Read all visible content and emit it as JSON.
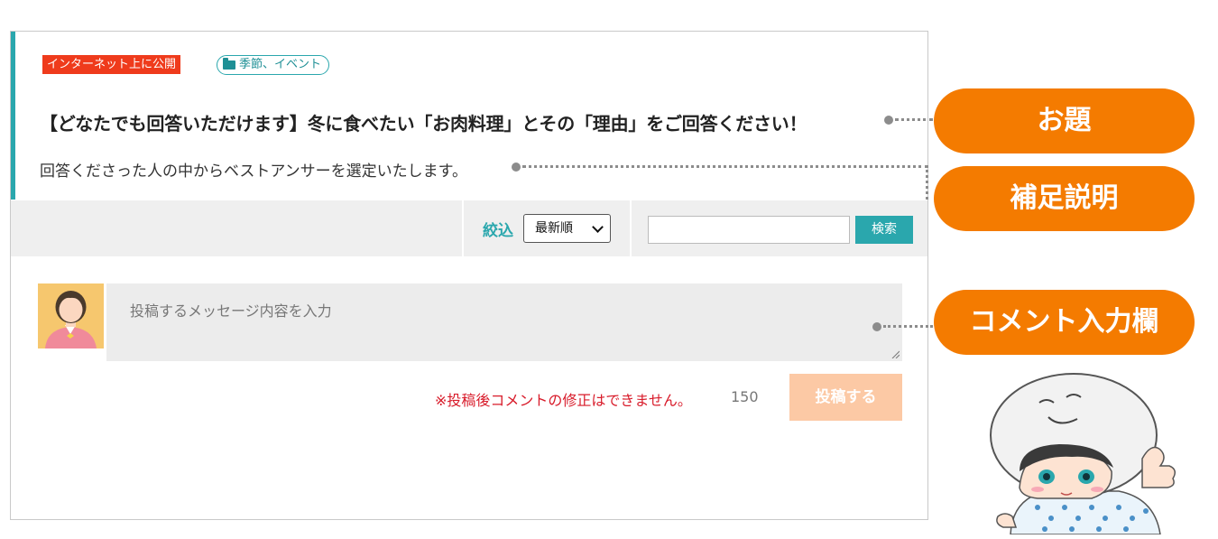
{
  "question": {
    "public_tag": "インターネット上に公開",
    "category_tag": "季節、イベント",
    "title": "【どなたでも回答いただけます】冬に食べたい「お肉料理」とその「理由」をご回答ください！",
    "description": "回答くださった人の中からベストアンサーを選定いたします。"
  },
  "filter": {
    "label": "絞込",
    "selected_option": "最新順",
    "search_value": "",
    "search_button": "検索"
  },
  "comment": {
    "placeholder": "投稿するメッセージ内容を入力",
    "notice": "※投稿後コメントの修正はできません。",
    "char_count": "150",
    "submit_button": "投稿する"
  },
  "callouts": {
    "topic": "お題",
    "supplement": "補足説明",
    "comment_field": "コメント入力欄"
  },
  "colors": {
    "accent": "#2aa7ad",
    "public_tag": "#ef3b1c",
    "callout": "#f47b00",
    "submit_disabled": "#fcc9a5",
    "notice": "#d81b2a"
  }
}
